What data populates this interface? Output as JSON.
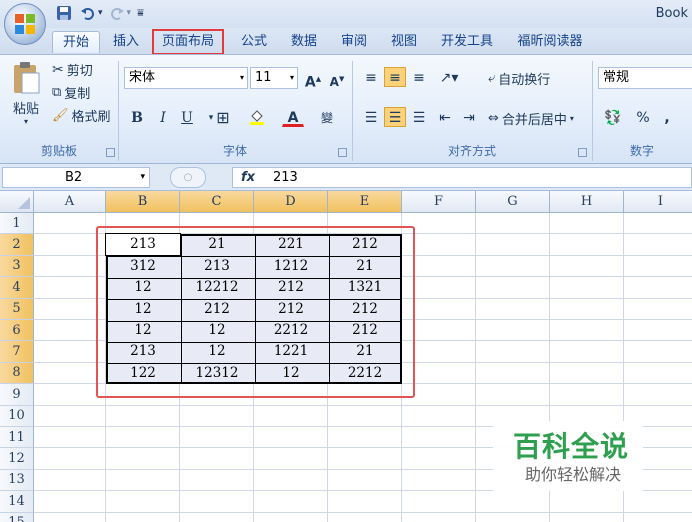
{
  "window": {
    "title": "Book"
  },
  "qat": {
    "dropdown_glyph": "▾"
  },
  "tabs": [
    {
      "label": "开始",
      "active": true
    },
    {
      "label": "插入"
    },
    {
      "label": "页面布局",
      "highlighted": true
    },
    {
      "label": "公式"
    },
    {
      "label": "数据"
    },
    {
      "label": "审阅"
    },
    {
      "label": "视图"
    },
    {
      "label": "开发工具"
    },
    {
      "label": "福昕阅读器"
    }
  ],
  "ribbon": {
    "clipboard": {
      "paste": "粘贴",
      "cut": "剪切",
      "copy": "复制",
      "format_painter": "格式刷",
      "group": "剪贴板"
    },
    "font": {
      "name": "宋体",
      "size": "11",
      "bold": "B",
      "italic": "I",
      "underline": "U",
      "grow": "A",
      "shrink": "A",
      "font_color": "A",
      "group": "字体"
    },
    "alignment": {
      "wrap": "自动换行",
      "merge": "合并后居中",
      "group": "对齐方式"
    },
    "number": {
      "format": "常规",
      "percent": "%",
      "comma": ",",
      "group": "数字"
    }
  },
  "formula_bar": {
    "name_box": "B2",
    "fx": "fx",
    "value": "213"
  },
  "columns": [
    "A",
    "B",
    "C",
    "D",
    "E",
    "F",
    "G",
    "H",
    "I"
  ],
  "rows": [
    "1",
    "2",
    "3",
    "4",
    "5",
    "6",
    "7",
    "8",
    "9",
    "10",
    "11",
    "12",
    "13",
    "14",
    "15"
  ],
  "table": [
    [
      "213",
      "21",
      "221",
      "212"
    ],
    [
      "312",
      "213",
      "1212",
      "21"
    ],
    [
      "12",
      "12212",
      "212",
      "1321"
    ],
    [
      "12",
      "212",
      "212",
      "212"
    ],
    [
      "12",
      "12",
      "2212",
      "212"
    ],
    [
      "213",
      "12",
      "1221",
      "21"
    ],
    [
      "122",
      "12312",
      "12",
      "2212"
    ]
  ],
  "watermark": {
    "title": "百科全说",
    "subtitle": "助你轻松解决"
  },
  "colors": {
    "accent_red": "#e23b3b",
    "selected_header": "#f1c15f",
    "watermark_green": "#2e9f4e"
  }
}
